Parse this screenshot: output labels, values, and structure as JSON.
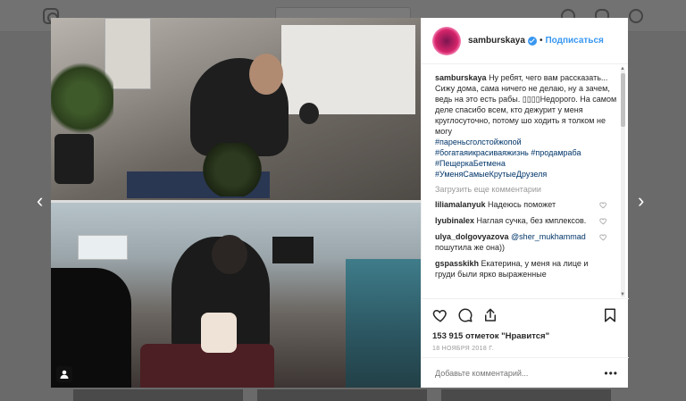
{
  "post": {
    "username": "samburskaya",
    "follow_label": "Подписаться",
    "separator": "•",
    "caption_text": "Ну ребят, чего вам рассказать... Сижу дома, сама ничего не делаю, ну а зачем, ведь на это есть рабы. ▯▯▯▯Недорого. На самом деле спасибо всем, кто дежурит у меня круглосуточно, потому шо ходить я толком не могу",
    "hashtags": [
      "#пареньсголстойжопой",
      "#богатаяикрасиваяжизнь",
      "#продамраба",
      "#ПещеркаБетмена",
      "#УменяСамыеКрутыеДрузеля"
    ],
    "load_more": "Загрузить еще комментарии",
    "comments": [
      {
        "user": "liliamalanyuk",
        "text": "Надеюсь поможет"
      },
      {
        "user": "lyubinalex",
        "text": "Наглая сучка, без кмплексов."
      },
      {
        "user": "ulya_dolgovyazova",
        "mention": "@sher_mukhammad",
        "text": " пошутила же она))"
      },
      {
        "user": "gspasskikh",
        "text": "Екатерина, у меня на лице и груди были ярко выраженные"
      }
    ],
    "likes_label": "153 915 отметок \"Нравится\"",
    "date": "18 НОЯБРЯ 2018 Г.",
    "add_comment_placeholder": "Добавьте комментарий...",
    "more_label": "•••"
  },
  "nav": {
    "prev": "‹",
    "next": "›"
  },
  "colors": {
    "link": "#3897f0",
    "hashtag": "#003569",
    "verified": "#3897f0"
  }
}
